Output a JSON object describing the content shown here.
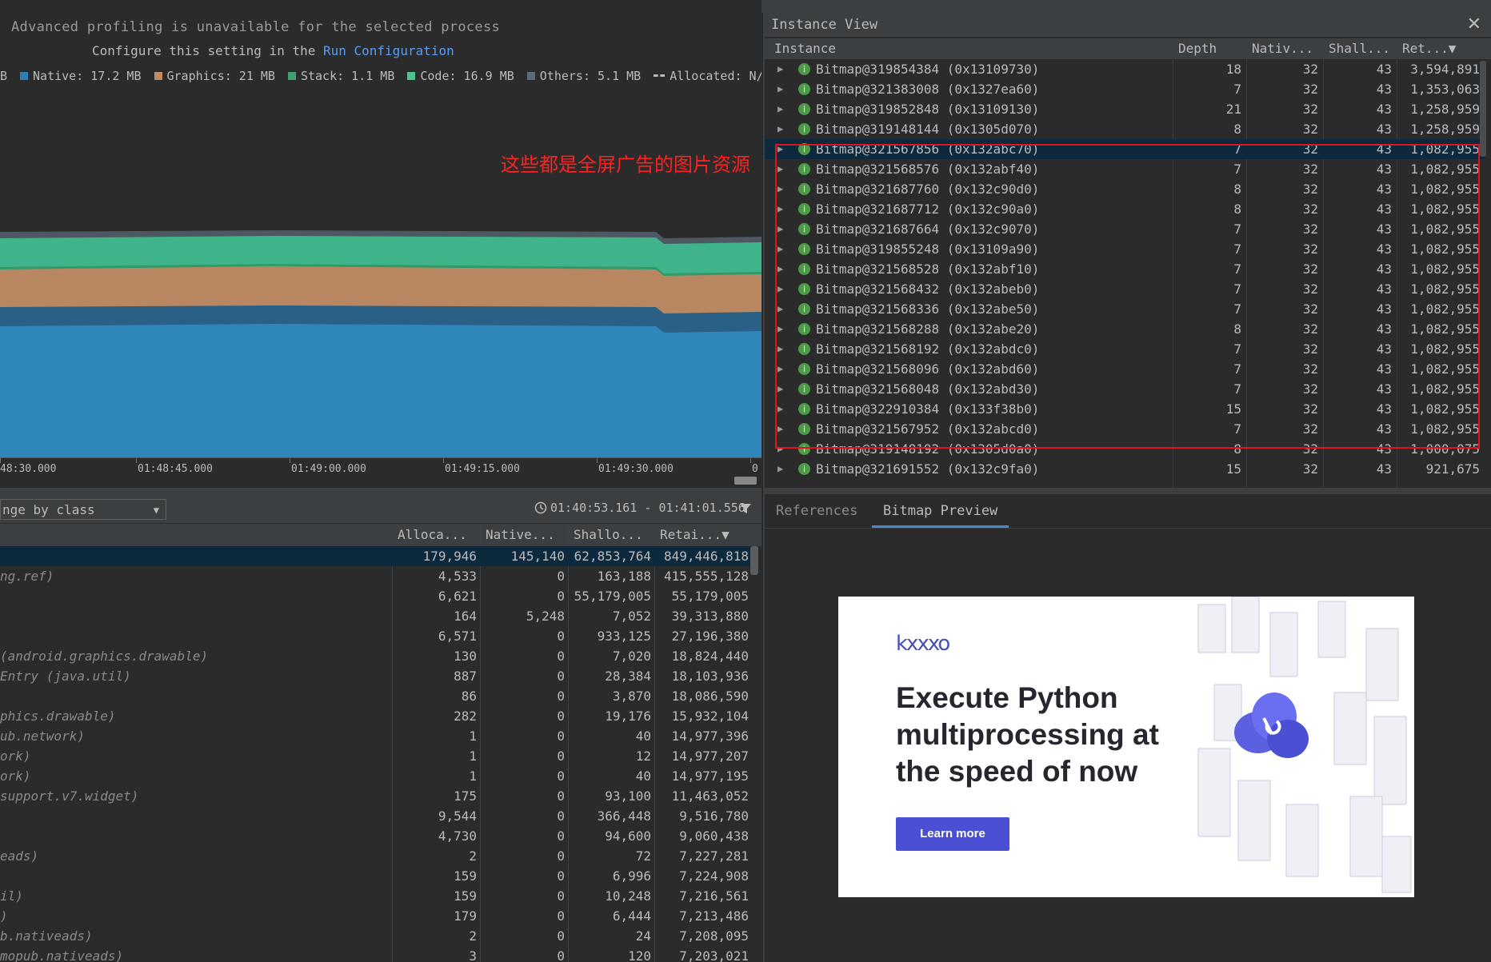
{
  "notice": {
    "line1": "Advanced profiling is unavailable for the selected process",
    "line2_prefix": "Configure this setting in the ",
    "line2_link": "Run Configuration"
  },
  "legend": [
    {
      "label": "B",
      "color": ""
    },
    {
      "label": "Native: 17.2 MB",
      "color": "#2f7fb5"
    },
    {
      "label": "Graphics: 21 MB",
      "color": "#c18c63"
    },
    {
      "label": "Stack: 1.1 MB",
      "color": "#40a070"
    },
    {
      "label": "Code: 16.9 MB",
      "color": "#4cc28c"
    },
    {
      "label": "Others: 5.1 MB",
      "color": "#5c6b78"
    },
    {
      "label": "Allocated: N/A",
      "color": "dash"
    }
  ],
  "annotation": "这些都是全屏广告的图片资源",
  "memory_chart": {
    "type": "area",
    "x_ticks": [
      "48:30.000",
      "01:48:45.000",
      "01:49:00.000",
      "01:49:15.000",
      "01:49:30.000",
      "0"
    ]
  },
  "toolbar": {
    "arrange_value": "nge by class",
    "time_range": "01:40:53.161 - 01:41:01.556"
  },
  "class_table": {
    "columns": [
      "Alloca...",
      "Native...",
      "Shallo...",
      "Retai...▼"
    ],
    "rows": [
      {
        "name": "",
        "alloc": "179,946",
        "native": "145,140",
        "shallow": "62,853,764",
        "retained": "849,446,818",
        "selected": true
      },
      {
        "name": "ng.ref)",
        "alloc": "4,533",
        "native": "0",
        "shallow": "163,188",
        "retained": "415,555,128"
      },
      {
        "name": "",
        "alloc": "6,621",
        "native": "0",
        "shallow": "55,179,005",
        "retained": "55,179,005"
      },
      {
        "name": "",
        "alloc": "164",
        "native": "5,248",
        "shallow": "7,052",
        "retained": "39,313,880"
      },
      {
        "name": "",
        "alloc": "6,571",
        "native": "0",
        "shallow": "933,125",
        "retained": "27,196,380"
      },
      {
        "name": "(android.graphics.drawable)",
        "alloc": "130",
        "native": "0",
        "shallow": "7,020",
        "retained": "18,824,440"
      },
      {
        "name": "Entry (java.util)",
        "alloc": "887",
        "native": "0",
        "shallow": "28,384",
        "retained": "18,103,936"
      },
      {
        "name": "",
        "alloc": "86",
        "native": "0",
        "shallow": "3,870",
        "retained": "18,086,590"
      },
      {
        "name": "phics.drawable)",
        "alloc": "282",
        "native": "0",
        "shallow": "19,176",
        "retained": "15,932,104"
      },
      {
        "name": "ub.network)",
        "alloc": "1",
        "native": "0",
        "shallow": "40",
        "retained": "14,977,396"
      },
      {
        "name": "ork)",
        "alloc": "1",
        "native": "0",
        "shallow": "12",
        "retained": "14,977,207"
      },
      {
        "name": "ork)",
        "alloc": "1",
        "native": "0",
        "shallow": "40",
        "retained": "14,977,195"
      },
      {
        "name": "support.v7.widget)",
        "alloc": "175",
        "native": "0",
        "shallow": "93,100",
        "retained": "11,463,052"
      },
      {
        "name": "",
        "alloc": "9,544",
        "native": "0",
        "shallow": "366,448",
        "retained": "9,516,780"
      },
      {
        "name": "",
        "alloc": "4,730",
        "native": "0",
        "shallow": "94,600",
        "retained": "9,060,438"
      },
      {
        "name": "eads)",
        "alloc": "2",
        "native": "0",
        "shallow": "72",
        "retained": "7,227,281"
      },
      {
        "name": "",
        "alloc": "159",
        "native": "0",
        "shallow": "6,996",
        "retained": "7,224,908"
      },
      {
        "name": "il)",
        "alloc": "159",
        "native": "0",
        "shallow": "10,248",
        "retained": "7,216,561"
      },
      {
        "name": ")",
        "alloc": "179",
        "native": "0",
        "shallow": "6,444",
        "retained": "7,213,486"
      },
      {
        "name": "b.nativeads)",
        "alloc": "2",
        "native": "0",
        "shallow": "24",
        "retained": "7,208,095"
      },
      {
        "name": "mopub.nativeads)",
        "alloc": "3",
        "native": "0",
        "shallow": "120",
        "retained": "7,203,021"
      }
    ]
  },
  "instance_view": {
    "title": "Instance View",
    "columns": [
      "Instance",
      "Depth",
      "Nativ...",
      "Shall...",
      "Ret...▼"
    ],
    "rows": [
      {
        "name": "Bitmap@319854384 (0x13109730)",
        "depth": "18",
        "native": "32",
        "shallow": "43",
        "retained": "3,594,891"
      },
      {
        "name": "Bitmap@321383008 (0x1327ea60)",
        "depth": "7",
        "native": "32",
        "shallow": "43",
        "retained": "1,353,063"
      },
      {
        "name": "Bitmap@319852848 (0x13109130)",
        "depth": "21",
        "native": "32",
        "shallow": "43",
        "retained": "1,258,959"
      },
      {
        "name": "Bitmap@319148144 (0x1305d070)",
        "depth": "8",
        "native": "32",
        "shallow": "43",
        "retained": "1,258,959"
      },
      {
        "name": "Bitmap@321567856 (0x132abc70)",
        "depth": "7",
        "native": "32",
        "shallow": "43",
        "retained": "1,082,955",
        "selected": true
      },
      {
        "name": "Bitmap@321568576 (0x132abf40)",
        "depth": "7",
        "native": "32",
        "shallow": "43",
        "retained": "1,082,955"
      },
      {
        "name": "Bitmap@321687760 (0x132c90d0)",
        "depth": "8",
        "native": "32",
        "shallow": "43",
        "retained": "1,082,955"
      },
      {
        "name": "Bitmap@321687712 (0x132c90a0)",
        "depth": "8",
        "native": "32",
        "shallow": "43",
        "retained": "1,082,955"
      },
      {
        "name": "Bitmap@321687664 (0x132c9070)",
        "depth": "7",
        "native": "32",
        "shallow": "43",
        "retained": "1,082,955"
      },
      {
        "name": "Bitmap@319855248 (0x13109a90)",
        "depth": "7",
        "native": "32",
        "shallow": "43",
        "retained": "1,082,955"
      },
      {
        "name": "Bitmap@321568528 (0x132abf10)",
        "depth": "7",
        "native": "32",
        "shallow": "43",
        "retained": "1,082,955"
      },
      {
        "name": "Bitmap@321568432 (0x132abeb0)",
        "depth": "7",
        "native": "32",
        "shallow": "43",
        "retained": "1,082,955"
      },
      {
        "name": "Bitmap@321568336 (0x132abe50)",
        "depth": "7",
        "native": "32",
        "shallow": "43",
        "retained": "1,082,955"
      },
      {
        "name": "Bitmap@321568288 (0x132abe20)",
        "depth": "8",
        "native": "32",
        "shallow": "43",
        "retained": "1,082,955"
      },
      {
        "name": "Bitmap@321568192 (0x132abdc0)",
        "depth": "7",
        "native": "32",
        "shallow": "43",
        "retained": "1,082,955"
      },
      {
        "name": "Bitmap@321568096 (0x132abd60)",
        "depth": "7",
        "native": "32",
        "shallow": "43",
        "retained": "1,082,955"
      },
      {
        "name": "Bitmap@321568048 (0x132abd30)",
        "depth": "7",
        "native": "32",
        "shallow": "43",
        "retained": "1,082,955"
      },
      {
        "name": "Bitmap@322910384 (0x133f38b0)",
        "depth": "15",
        "native": "32",
        "shallow": "43",
        "retained": "1,082,955"
      },
      {
        "name": "Bitmap@321567952 (0x132abcd0)",
        "depth": "7",
        "native": "32",
        "shallow": "43",
        "retained": "1,082,955"
      },
      {
        "name": "Bitmap@319148192 (0x1305d0a0)",
        "depth": "8",
        "native": "32",
        "shallow": "43",
        "retained": "1,000,075"
      },
      {
        "name": "Bitmap@321691552 (0x132c9fa0)",
        "depth": "15",
        "native": "32",
        "shallow": "43",
        "retained": "921,675"
      }
    ]
  },
  "bottom_tabs": [
    {
      "label": "References",
      "active": false
    },
    {
      "label": "Bitmap Preview",
      "active": true
    }
  ],
  "bitmap_preview": {
    "logo": "kxxxo",
    "headline": "Execute Python multiprocessing at the speed of now",
    "button": "Learn more",
    "accent_color": "#4a4fd4"
  },
  "icons": {
    "instance": "info-icon",
    "expand": "triangle-right-icon",
    "close": "close-icon",
    "filter": "filter-icon",
    "clock": "clock-icon"
  }
}
